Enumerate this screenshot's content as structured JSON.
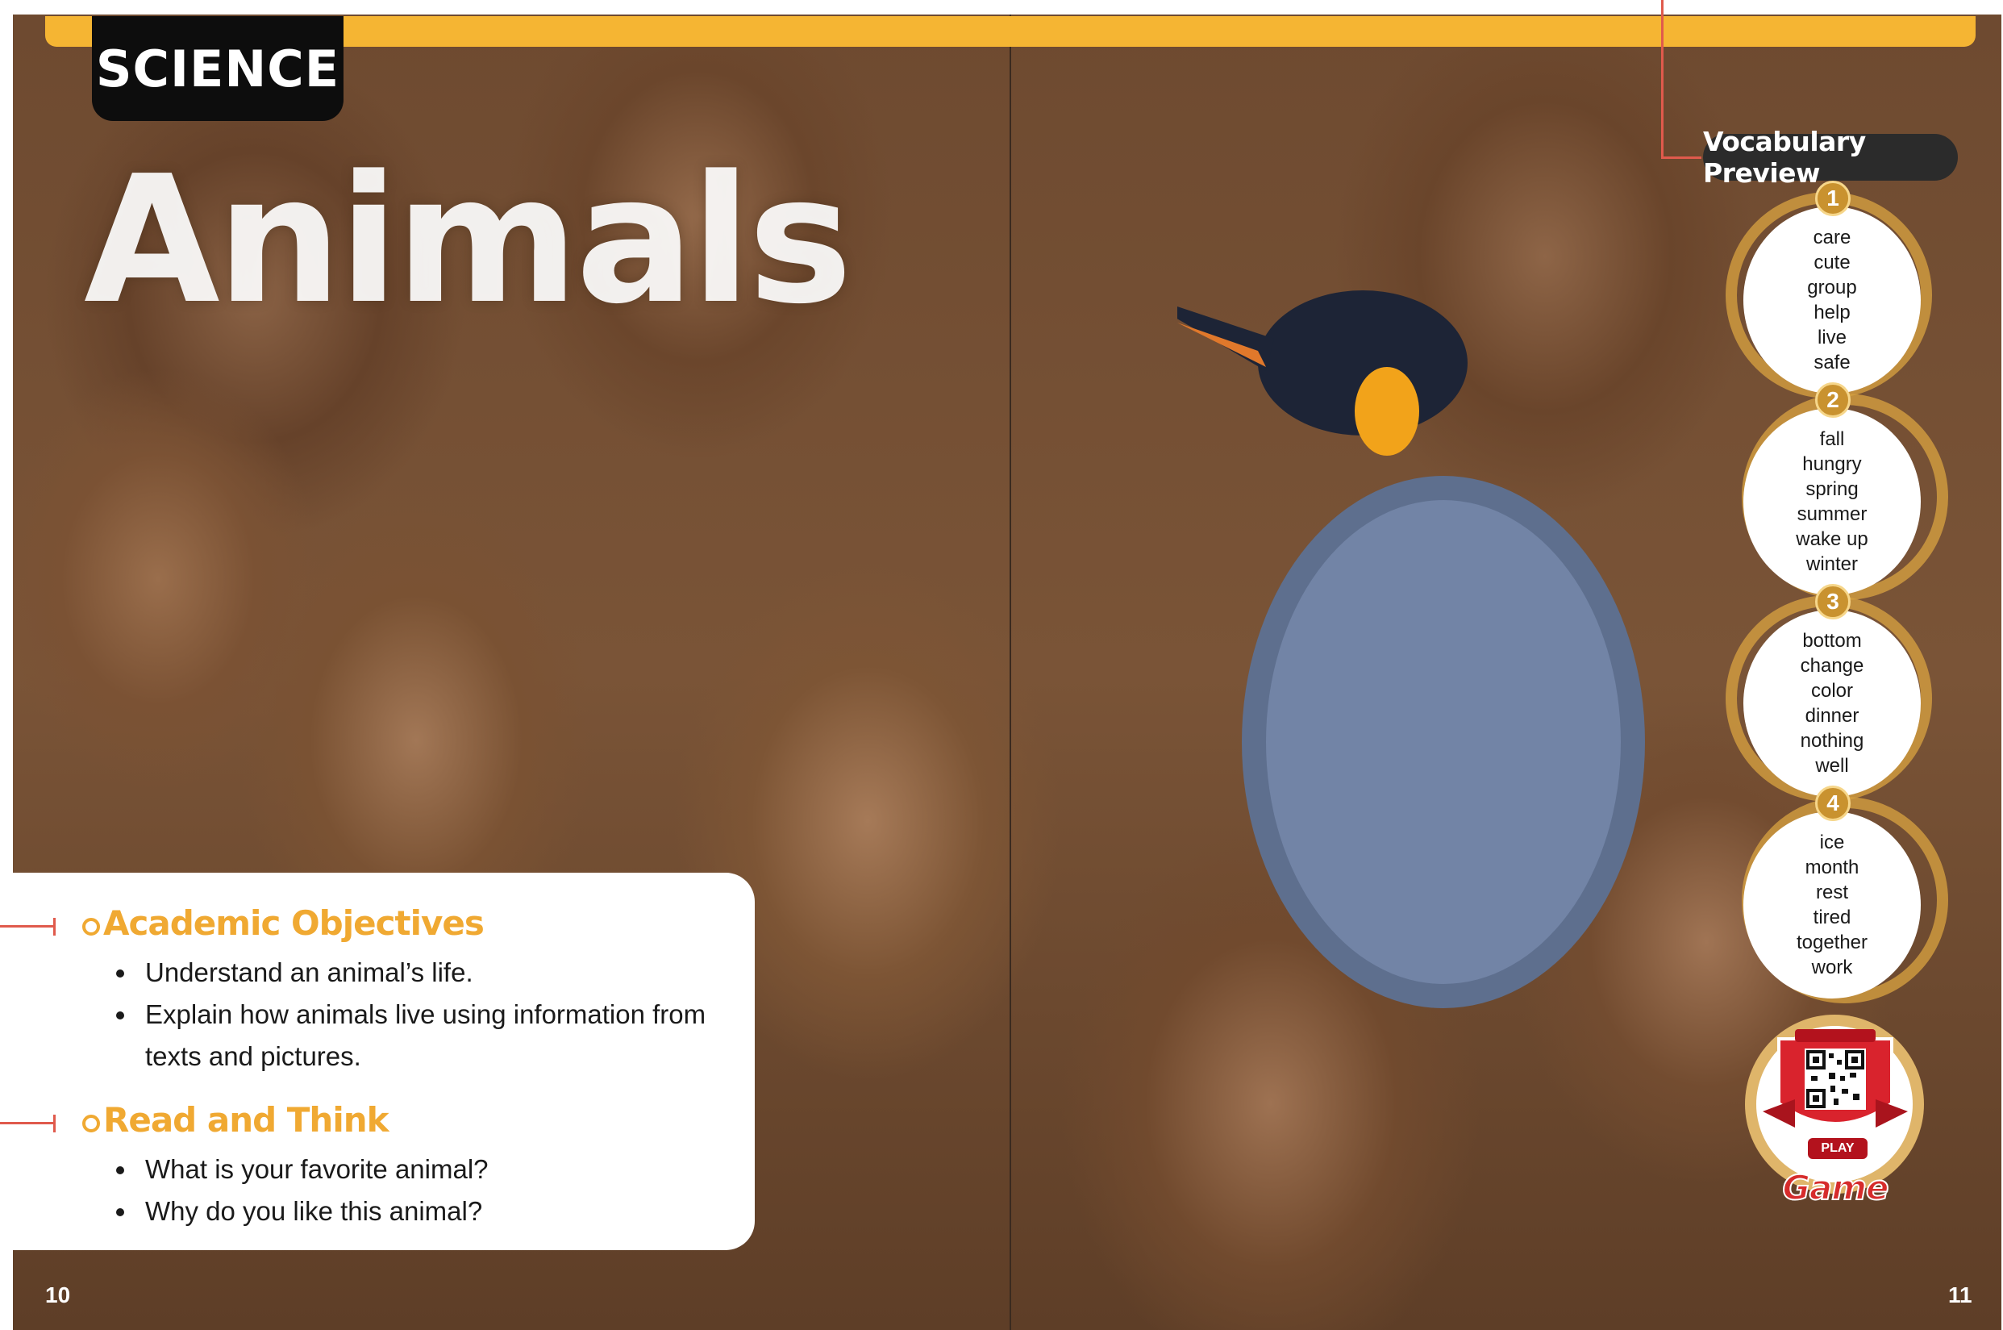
{
  "subject": "SCIENCE",
  "title": "Animals",
  "objectives": {
    "academic": {
      "heading": "Academic Objectives",
      "items": [
        "Understand an animal’s life.",
        "Explain how animals live using information from texts and pictures."
      ]
    },
    "read_think": {
      "heading": "Read and Think",
      "items": [
        "What is your favorite animal?",
        "Why do you like this animal?"
      ]
    }
  },
  "page_numbers": {
    "left": "10",
    "right": "11"
  },
  "vocabulary": {
    "label": "Vocabulary Preview",
    "groups": [
      {
        "number": "1",
        "words": [
          "care",
          "cute",
          "group",
          "help",
          "live",
          "safe"
        ]
      },
      {
        "number": "2",
        "words": [
          "fall",
          "hungry",
          "spring",
          "summer",
          "wake up",
          "winter"
        ]
      },
      {
        "number": "3",
        "words": [
          "bottom",
          "change",
          "color",
          "dinner",
          "nothing",
          "well"
        ]
      },
      {
        "number": "4",
        "words": [
          "ice",
          "month",
          "rest",
          "tired",
          "together",
          "work"
        ]
      }
    ]
  },
  "game": {
    "play_label": "PLAY",
    "label": "Game"
  },
  "colors": {
    "accent_orange": "#f5b533",
    "heading_orange": "#f0a932",
    "leader_red": "#e05a4c",
    "ring_gold": "#d6a040",
    "game_red": "#d62b2b"
  },
  "icons": [
    "qr-code-icon",
    "game-shield-icon",
    "penguin-photo"
  ]
}
